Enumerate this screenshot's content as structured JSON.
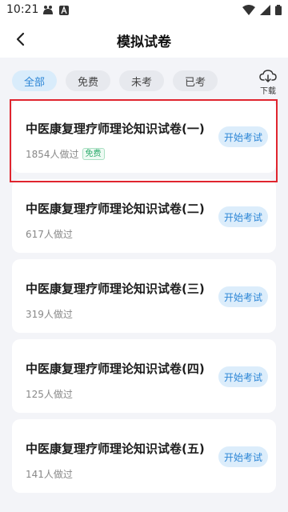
{
  "status_bar": {
    "time": "10:21"
  },
  "header": {
    "title": "模拟试卷"
  },
  "filters": {
    "all": "全部",
    "free": "免费",
    "untaken": "未考",
    "taken": "已考",
    "download_label": "下载",
    "active": "全部"
  },
  "exams": [
    {
      "title": "中医康复理疗师理论知识试卷(一)",
      "count_text": "1854人做过",
      "badge": "免费",
      "button": "开始考试"
    },
    {
      "title": "中医康复理疗师理论知识试卷(二)",
      "count_text": "617人做过",
      "button": "开始考试"
    },
    {
      "title": "中医康复理疗师理论知识试卷(三)",
      "count_text": "319人做过",
      "button": "开始考试"
    },
    {
      "title": "中医康复理疗师理论知识试卷(四)",
      "count_text": "125人做过",
      "button": "开始考试"
    },
    {
      "title": "中医康复理疗师理论知识试卷(五)",
      "count_text": "141人做过",
      "button": "开始考试"
    }
  ],
  "colors": {
    "accent": "#2d86d6",
    "accent_bg": "#dcedfb",
    "free_green": "#2cab6c",
    "highlight_red": "#e0252e"
  }
}
